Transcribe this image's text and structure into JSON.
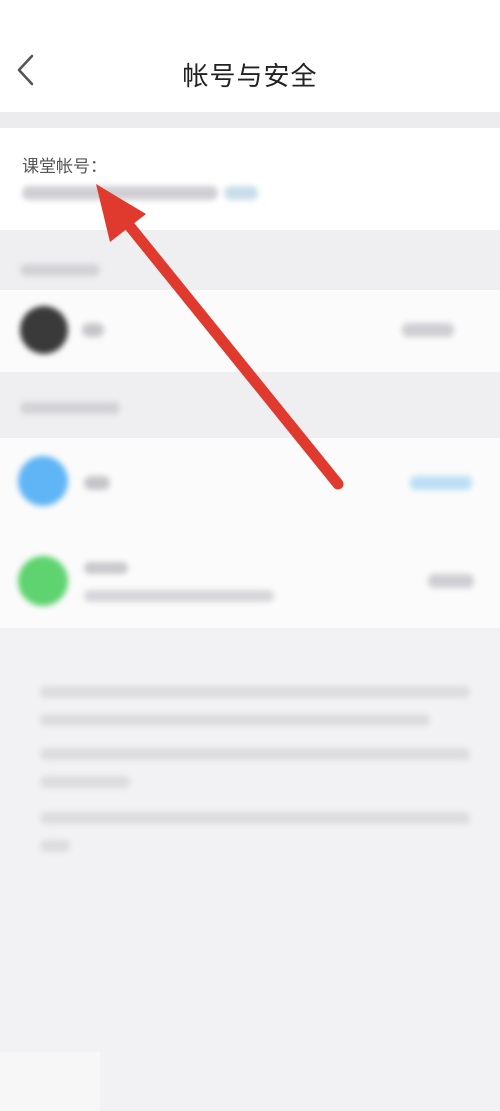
{
  "header": {
    "title": "帐号与安全",
    "back_icon": "chevron-left-icon"
  },
  "account": {
    "label": "课堂帐号："
  },
  "annotation": {
    "color": "#e03a2f",
    "icon": "red-arrow-pointer"
  }
}
